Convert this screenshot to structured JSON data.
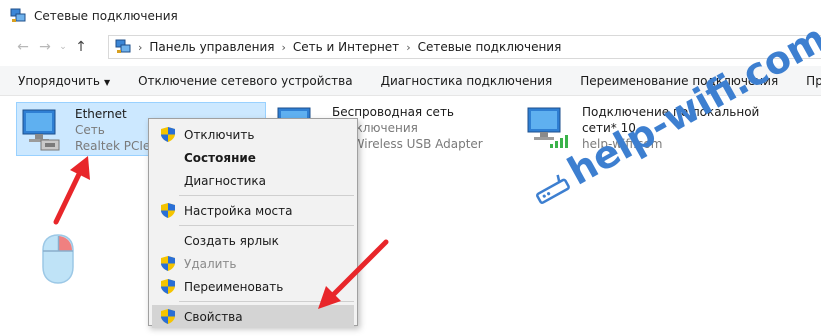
{
  "window": {
    "title": "Сетевые подключения",
    "icon": "network-connections-icon"
  },
  "address": {
    "breadcrumbs": [
      "Панель управления",
      "Сеть и Интернет",
      "Сетевые подключения"
    ]
  },
  "toolbar": {
    "organize": "Упорядочить",
    "disable_device": "Отключение сетевого устройства",
    "diagnose": "Диагностика подключения",
    "rename": "Переименование подключения",
    "view_status": "Просмотр состо"
  },
  "connections": [
    {
      "name": "Ethernet",
      "status": "Сеть",
      "adapter": "Realtek PCIe G",
      "icon": "ethernet-adapter-icon",
      "selected": true
    },
    {
      "name": "Беспроводная сеть",
      "status": "подключения",
      "adapter": "NK Wireless USB Adapter",
      "icon": "wireless-adapter-icon",
      "selected": false
    },
    {
      "name": "Подключение по локальной",
      "name2": "сети* 10",
      "adapter": "help-wifi.com",
      "icon": "local-connection-icon",
      "selected": false
    }
  ],
  "context_menu": {
    "items": [
      {
        "label": "Отключить",
        "shield": true
      },
      {
        "label": "Состояние",
        "bold": true
      },
      {
        "label": "Диагностика"
      },
      {
        "label": "Настройка моста",
        "shield": true
      },
      {
        "label": "Создать ярлык"
      },
      {
        "label": "Удалить",
        "shield": true,
        "disabled": true
      },
      {
        "label": "Переименовать",
        "shield": true
      },
      {
        "label": "Свойства",
        "shield": true,
        "highlighted": true
      }
    ]
  },
  "annotations": {
    "watermark": "help-wifi.com",
    "arrow_color": "#e8262a",
    "mouse_icon": "mouse-right-click-icon"
  },
  "colors": {
    "selection_bg": "#cce8ff",
    "accent": "#3d7fd0",
    "shield_blue": "#2a6fd6",
    "shield_yellow": "#f5c400"
  }
}
